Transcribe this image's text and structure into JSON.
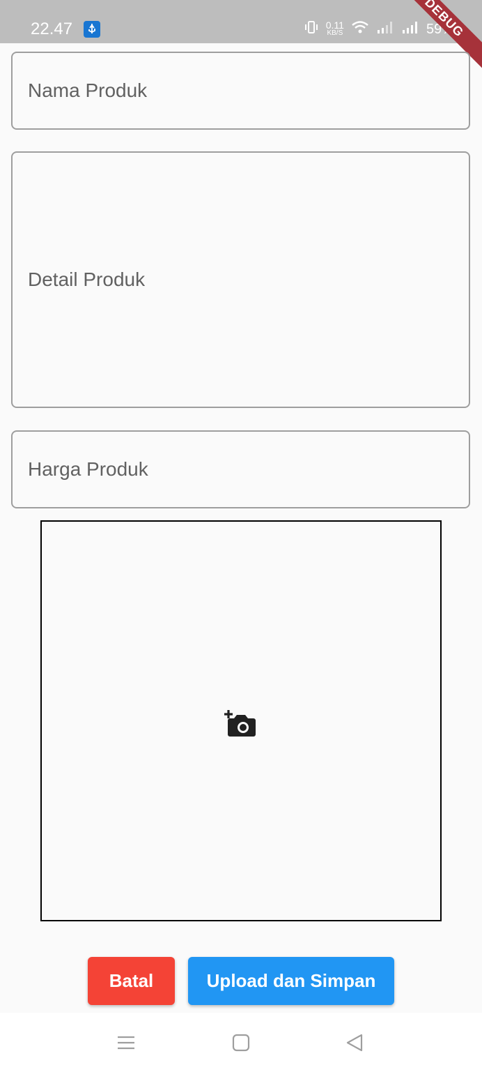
{
  "status_bar": {
    "time": "22.47",
    "net_speed_value": "0.11",
    "net_speed_unit": "KB/S",
    "battery": "59%",
    "debug_label": "DEBUG"
  },
  "form": {
    "name_label": "Nama Produk",
    "detail_label": "Detail Produk",
    "price_label": "Harga Produk"
  },
  "image_picker": {
    "icon": "add-a-photo-icon"
  },
  "buttons": {
    "cancel_label": "Batal",
    "upload_label": "Upload dan Simpan"
  },
  "colors": {
    "cancel": "#f44336",
    "upload": "#2196f3",
    "debug_ribbon": "#a6323a"
  },
  "nav_bar": {
    "icons": [
      "menu-icon",
      "home-square-icon",
      "back-triangle-icon"
    ]
  }
}
